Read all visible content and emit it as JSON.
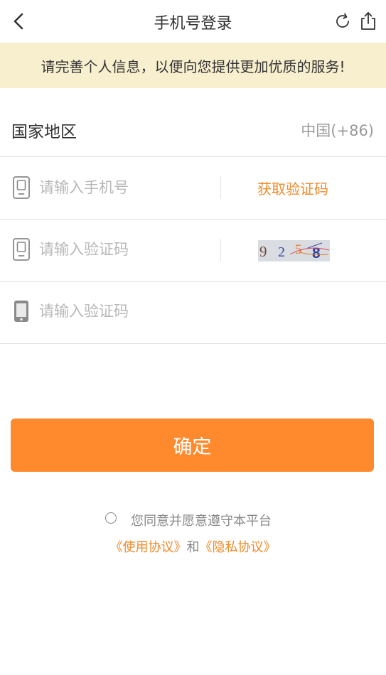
{
  "header": {
    "title": "手机号登录",
    "back_icon": "chevron-left-icon",
    "refresh_icon": "refresh-icon",
    "share_icon": "share-icon"
  },
  "notice": {
    "text": "请完善个人信息，以便向您提供更加优质的服务!"
  },
  "region": {
    "label": "国家地区",
    "value": "中国(+86)"
  },
  "phone_field": {
    "placeholder": "请输入手机号",
    "value": "",
    "get_code_label": "获取验证码"
  },
  "captcha_field": {
    "placeholder": "请输入验证码",
    "value": "",
    "captcha_text": "9258"
  },
  "sms_field": {
    "placeholder": "请输入验证码",
    "value": ""
  },
  "confirm_button": {
    "label": "确定"
  },
  "agreement": {
    "text": "您同意并愿意遵守本平台",
    "terms_link": "《使用协议》",
    "and_text": "和",
    "privacy_link": "《隐私协议》",
    "checked": false
  },
  "colors": {
    "accent": "#ff8a2d",
    "link": "#f08a2a",
    "notice_bg": "#f8efcf",
    "divider": "#e3e3e3"
  }
}
